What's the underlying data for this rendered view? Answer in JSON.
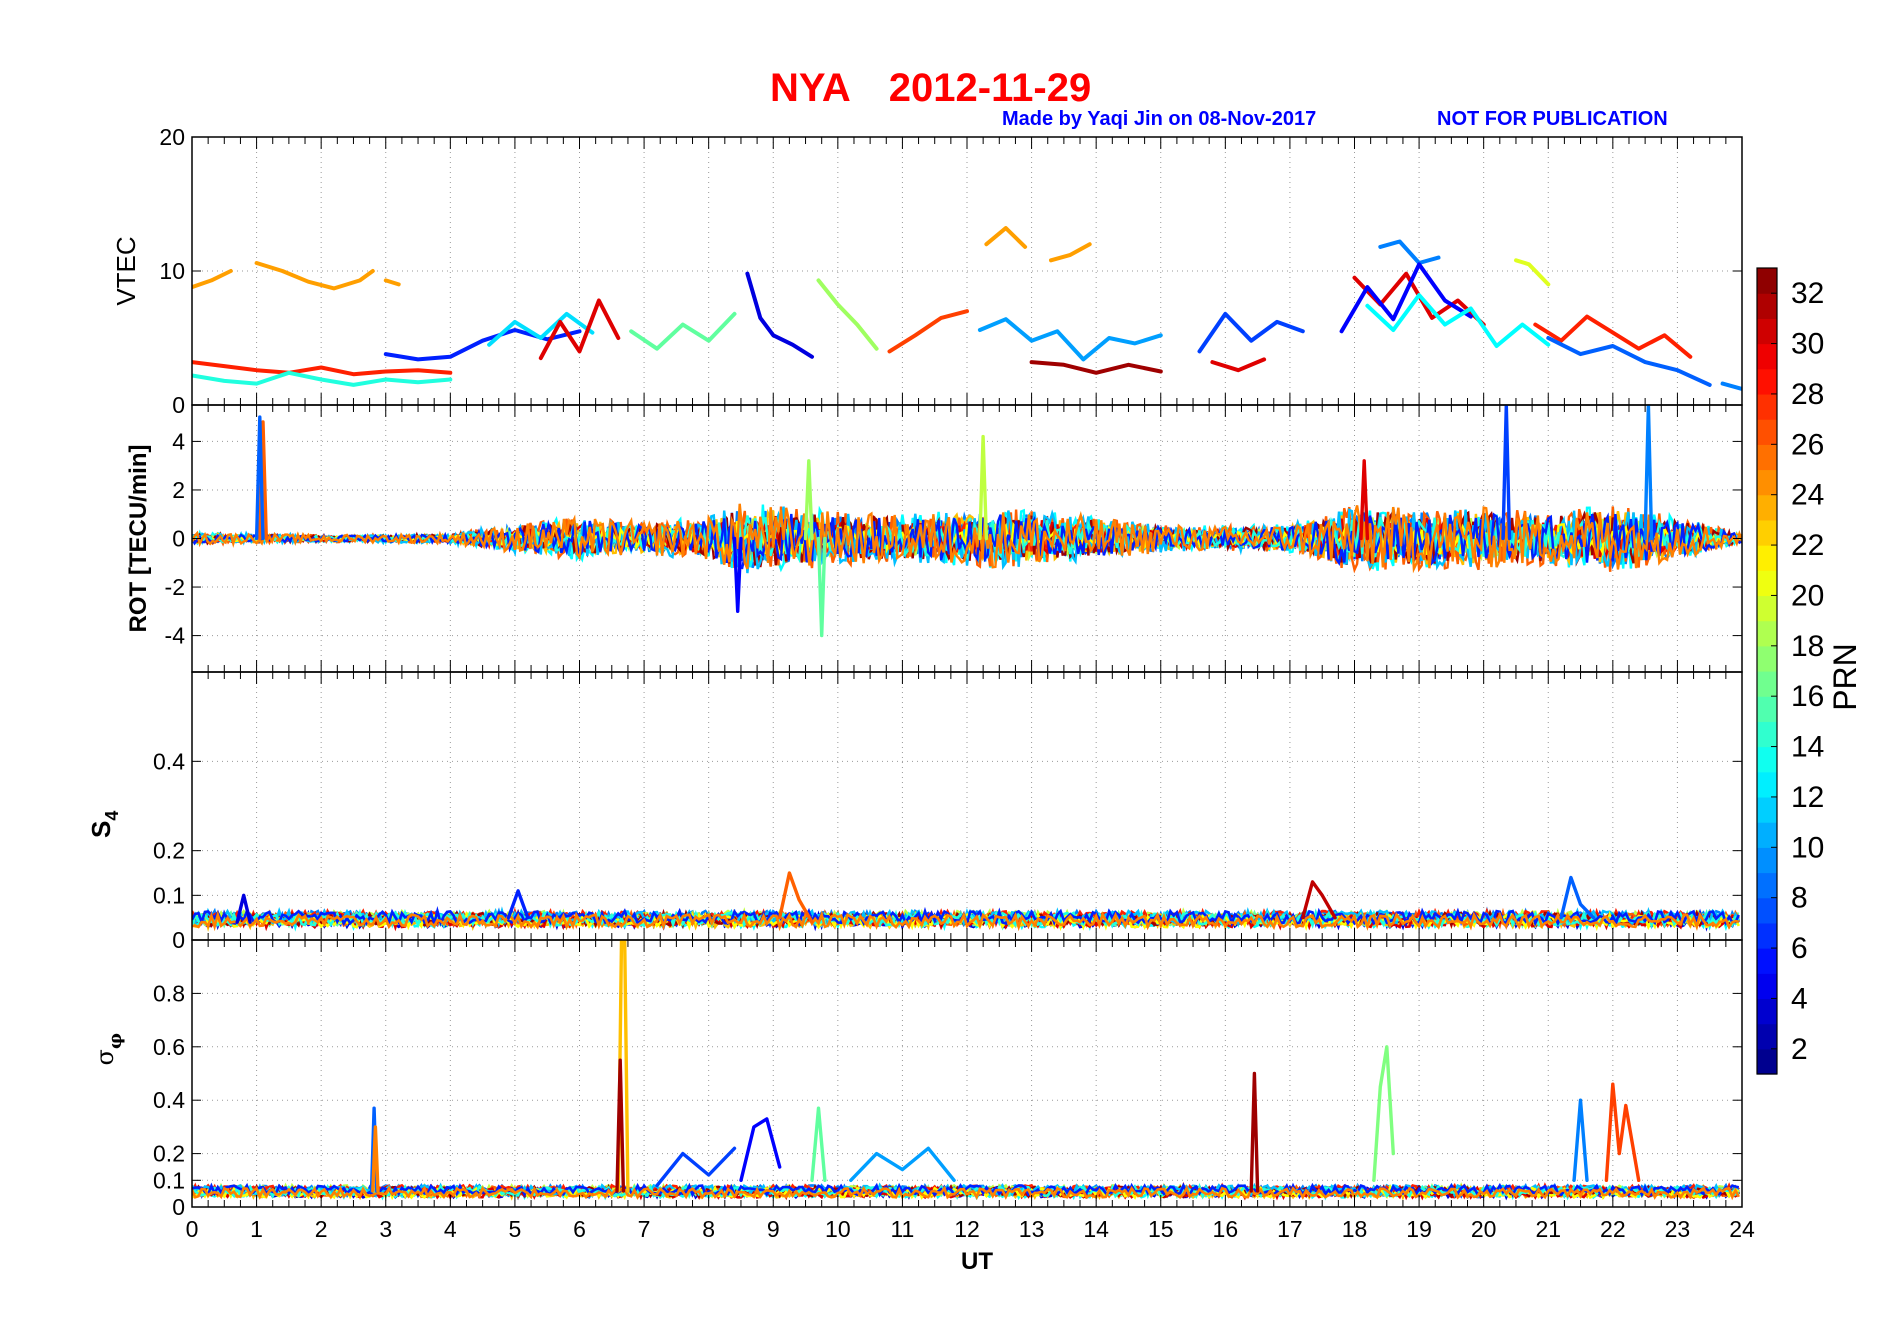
{
  "title": {
    "station": "NYA",
    "date": "2012-11-29"
  },
  "credit": "Made by Yaqi Jin on 08-Nov-2017",
  "notice": "NOT FOR PUBLICATION",
  "colors": {
    "title": "#ff0000",
    "notice": "#0000ff",
    "colormap": "jet"
  },
  "chart_data": [
    {
      "type": "line",
      "panel": "VTEC",
      "ylabel": "VTEC",
      "xlim": [
        0,
        24
      ],
      "ylim": [
        0,
        20
      ],
      "yticks": [
        "0",
        "10",
        "20"
      ],
      "grid": true,
      "series": [
        {
          "prn": 24,
          "x": [
            0.0,
            0.3,
            0.6
          ],
          "y": [
            8.8,
            9.3,
            10.0
          ]
        },
        {
          "prn": 24,
          "x": [
            1.0,
            1.4,
            1.8,
            2.2,
            2.6,
            2.8
          ],
          "y": [
            10.6,
            10.0,
            9.2,
            8.7,
            9.3,
            10.0
          ]
        },
        {
          "prn": 24,
          "x": [
            3.0,
            3.2
          ],
          "y": [
            9.3,
            9.0
          ]
        },
        {
          "prn": 24,
          "x": [
            12.3,
            12.6,
            12.9
          ],
          "y": [
            12.0,
            13.2,
            11.8
          ]
        },
        {
          "prn": 24,
          "x": [
            13.3,
            13.6,
            13.9
          ],
          "y": [
            10.8,
            11.2,
            12.0
          ]
        },
        {
          "prn": 9,
          "x": [
            18.4,
            18.7,
            19.0,
            19.3
          ],
          "y": [
            11.8,
            12.2,
            10.6,
            11.0
          ]
        },
        {
          "prn": 20,
          "x": [
            20.5,
            20.7,
            21.0
          ],
          "y": [
            10.8,
            10.5,
            9.0
          ]
        },
        {
          "prn": 30,
          "x": [
            18.0,
            18.4,
            18.8,
            19.2,
            19.6,
            20.0
          ],
          "y": [
            9.5,
            7.5,
            9.8,
            6.5,
            7.8,
            6.0
          ]
        },
        {
          "prn": 28,
          "x": [
            0.0,
            0.5,
            1.0,
            1.5,
            2.0,
            2.5,
            3.0,
            3.5,
            4.0
          ],
          "y": [
            3.2,
            2.9,
            2.6,
            2.4,
            2.8,
            2.3,
            2.5,
            2.6,
            2.4
          ]
        },
        {
          "prn": 14,
          "x": [
            0.0,
            0.5,
            1.0,
            1.5,
            2.0,
            2.5,
            3.0,
            3.5,
            4.0
          ],
          "y": [
            2.2,
            1.8,
            1.6,
            2.4,
            1.9,
            1.5,
            1.9,
            1.7,
            1.9
          ]
        },
        {
          "prn": 6,
          "x": [
            3.0,
            3.5,
            4.0,
            4.5,
            5.0,
            5.5,
            6.0
          ],
          "y": [
            3.8,
            3.4,
            3.6,
            4.8,
            5.6,
            4.9,
            5.5
          ]
        },
        {
          "prn": 12,
          "x": [
            4.6,
            5.0,
            5.4,
            5.8,
            6.2
          ],
          "y": [
            4.5,
            6.2,
            5.0,
            6.8,
            5.4
          ]
        },
        {
          "prn": 30,
          "x": [
            5.4,
            5.7,
            6.0,
            6.3,
            6.6
          ],
          "y": [
            3.5,
            6.2,
            4.0,
            7.8,
            5.0
          ]
        },
        {
          "prn": 16,
          "x": [
            6.8,
            7.2,
            7.6,
            8.0,
            8.4
          ],
          "y": [
            5.5,
            4.2,
            6.0,
            4.8,
            6.8
          ]
        },
        {
          "prn": 4,
          "x": [
            8.6,
            8.8,
            9.0,
            9.3,
            9.6
          ],
          "y": [
            9.8,
            6.5,
            5.2,
            4.5,
            3.6
          ]
        },
        {
          "prn": 18,
          "x": [
            9.7,
            10.0,
            10.3,
            10.6
          ],
          "y": [
            9.3,
            7.5,
            6.0,
            4.2
          ]
        },
        {
          "prn": 27,
          "x": [
            10.8,
            11.2,
            11.6,
            12.0
          ],
          "y": [
            4.0,
            5.2,
            6.5,
            7.0
          ]
        },
        {
          "prn": 10,
          "x": [
            12.2,
            12.6,
            13.0,
            13.4,
            13.8,
            14.2,
            14.6,
            15.0
          ],
          "y": [
            5.6,
            6.4,
            4.8,
            5.5,
            3.4,
            5.0,
            4.6,
            5.2
          ]
        },
        {
          "prn": 32,
          "x": [
            13.0,
            13.5,
            14.0,
            14.5,
            15.0
          ],
          "y": [
            3.2,
            3.0,
            2.4,
            3.0,
            2.5
          ]
        },
        {
          "prn": 7,
          "x": [
            15.6,
            16.0,
            16.4,
            16.8,
            17.2
          ],
          "y": [
            4.0,
            6.8,
            4.8,
            6.2,
            5.5
          ]
        },
        {
          "prn": 30,
          "x": [
            15.8,
            16.2,
            16.6
          ],
          "y": [
            3.2,
            2.6,
            3.4
          ]
        },
        {
          "prn": 5,
          "x": [
            17.8,
            18.2,
            18.6,
            19.0,
            19.4,
            19.8
          ],
          "y": [
            5.5,
            8.8,
            6.4,
            10.5,
            7.8,
            6.6
          ]
        },
        {
          "prn": 13,
          "x": [
            18.2,
            18.6,
            19.0,
            19.4,
            19.8,
            20.2,
            20.6,
            21.0
          ],
          "y": [
            7.4,
            5.6,
            8.2,
            6.0,
            7.2,
            4.4,
            6.0,
            4.5
          ]
        },
        {
          "prn": 28,
          "x": [
            20.8,
            21.2,
            21.6,
            22.0,
            22.4,
            22.8,
            23.2
          ],
          "y": [
            6.0,
            4.8,
            6.6,
            5.4,
            4.2,
            5.2,
            3.6
          ]
        },
        {
          "prn": 8,
          "x": [
            21.0,
            21.5,
            22.0,
            22.5,
            23.0,
            23.5
          ],
          "y": [
            5.0,
            3.8,
            4.4,
            3.2,
            2.6,
            1.5
          ]
        },
        {
          "prn": 9,
          "x": [
            23.7,
            24.0
          ],
          "y": [
            1.6,
            1.2
          ]
        }
      ]
    },
    {
      "type": "line",
      "panel": "ROT",
      "ylabel": "ROT [TECU/min]",
      "xlim": [
        0,
        24
      ],
      "ylim": [
        -5.5,
        5.5
      ],
      "yticks": [
        "-4",
        "-2",
        "0",
        "2",
        "4"
      ],
      "grid": true,
      "noise_envelope": {
        "x": [
          0,
          2,
          4,
          5,
          6,
          7,
          8,
          8.5,
          9,
          10,
          11,
          12,
          13,
          14,
          15,
          16,
          17,
          18,
          19,
          20,
          21,
          22,
          23,
          24
        ],
        "amp": [
          0.25,
          0.15,
          0.2,
          0.6,
          0.9,
          0.7,
          0.9,
          1.5,
          1.4,
          1.1,
          1.0,
          1.2,
          1.2,
          0.9,
          0.6,
          0.5,
          0.6,
          1.4,
          1.3,
          1.3,
          1.1,
          1.4,
          0.9,
          0.2
        ]
      },
      "series": [
        {
          "prn": 26,
          "x": [
            1.05,
            1.1,
            1.15
          ],
          "y": [
            0.0,
            4.8,
            0.0
          ]
        },
        {
          "prn": 8,
          "x": [
            1.0,
            1.05,
            1.1
          ],
          "y": [
            0.0,
            5.0,
            0.0
          ]
        },
        {
          "prn": 5,
          "x": [
            8.4,
            8.45,
            8.5
          ],
          "y": [
            0.0,
            -3.0,
            0.0
          ]
        },
        {
          "prn": 16,
          "x": [
            9.7,
            9.75,
            9.8
          ],
          "y": [
            0.0,
            -4.0,
            0.0
          ]
        },
        {
          "prn": 18,
          "x": [
            9.5,
            9.55,
            9.6
          ],
          "y": [
            0.0,
            3.2,
            0.0
          ]
        },
        {
          "prn": 19,
          "x": [
            12.2,
            12.25,
            12.3
          ],
          "y": [
            0.0,
            4.2,
            0.0
          ]
        },
        {
          "prn": 7,
          "x": [
            20.3,
            20.35,
            20.4
          ],
          "y": [
            0.0,
            5.5,
            0.0
          ]
        },
        {
          "prn": 9,
          "x": [
            22.5,
            22.55,
            22.6
          ],
          "y": [
            0.0,
            5.5,
            0.0
          ]
        },
        {
          "prn": 30,
          "x": [
            18.1,
            18.15,
            18.2
          ],
          "y": [
            0.0,
            3.2,
            0.0
          ]
        }
      ]
    },
    {
      "type": "line",
      "panel": "S4",
      "ylabel": "S4",
      "xlim": [
        0,
        24
      ],
      "ylim": [
        0,
        0.6
      ],
      "yticks": [
        "0",
        "0.1",
        "0.2",
        "0.4"
      ],
      "grid": true,
      "baseline": 0.04,
      "series": [
        {
          "prn": 26,
          "x": [
            9.1,
            9.25,
            9.4,
            9.6
          ],
          "y": [
            0.05,
            0.15,
            0.09,
            0.04
          ]
        },
        {
          "prn": 31,
          "x": [
            17.2,
            17.35,
            17.5,
            17.7
          ],
          "y": [
            0.05,
            0.13,
            0.1,
            0.05
          ]
        },
        {
          "prn": 8,
          "x": [
            21.2,
            21.35,
            21.5,
            21.7
          ],
          "y": [
            0.05,
            0.14,
            0.08,
            0.05
          ]
        },
        {
          "prn": 6,
          "x": [
            4.9,
            5.05,
            5.2
          ],
          "y": [
            0.05,
            0.11,
            0.05
          ]
        },
        {
          "prn": 4,
          "x": [
            0.7,
            0.8,
            0.9
          ],
          "y": [
            0.04,
            0.1,
            0.04
          ]
        }
      ]
    },
    {
      "type": "line",
      "panel": "sigma_phi",
      "ylabel": "σφ",
      "xlim": [
        0,
        24
      ],
      "ylim": [
        0,
        1
      ],
      "yticks": [
        "0",
        "0.1",
        "0.2",
        "0.4",
        "0.6",
        "0.8"
      ],
      "xticks": [
        "0",
        "1",
        "2",
        "3",
        "4",
        "5",
        "6",
        "7",
        "8",
        "9",
        "10",
        "11",
        "12",
        "13",
        "14",
        "15",
        "16",
        "17",
        "18",
        "19",
        "20",
        "21",
        "22",
        "23",
        "24"
      ],
      "xlabel": "UT",
      "grid": true,
      "baseline": 0.05,
      "series": [
        {
          "prn": 23,
          "x": [
            6.6,
            6.65,
            6.7,
            6.75
          ],
          "y": [
            0.06,
            1.0,
            1.0,
            0.06
          ]
        },
        {
          "prn": 32,
          "x": [
            6.58,
            6.63,
            6.68
          ],
          "y": [
            0.06,
            0.55,
            0.06
          ]
        },
        {
          "prn": 8,
          "x": [
            2.78,
            2.82,
            2.86
          ],
          "y": [
            0.06,
            0.37,
            0.06
          ]
        },
        {
          "prn": 25,
          "x": [
            2.8,
            2.84,
            2.88
          ],
          "y": [
            0.06,
            0.3,
            0.06
          ]
        },
        {
          "prn": 32,
          "x": [
            16.4,
            16.45,
            16.5
          ],
          "y": [
            0.06,
            0.5,
            0.06
          ]
        },
        {
          "prn": 17,
          "x": [
            18.3,
            18.4,
            18.5,
            18.6
          ],
          "y": [
            0.1,
            0.45,
            0.6,
            0.2
          ]
        },
        {
          "prn": 27,
          "x": [
            21.9,
            22.0,
            22.1,
            22.2,
            22.4
          ],
          "y": [
            0.1,
            0.46,
            0.2,
            0.38,
            0.1
          ]
        },
        {
          "prn": 5,
          "x": [
            8.5,
            8.7,
            8.9,
            9.1
          ],
          "y": [
            0.1,
            0.3,
            0.33,
            0.15
          ]
        },
        {
          "prn": 16,
          "x": [
            9.6,
            9.7,
            9.8
          ],
          "y": [
            0.1,
            0.37,
            0.1
          ]
        },
        {
          "prn": 9,
          "x": [
            21.4,
            21.5,
            21.6
          ],
          "y": [
            0.1,
            0.4,
            0.1
          ]
        },
        {
          "prn": 7,
          "x": [
            7.2,
            7.6,
            8.0,
            8.4
          ],
          "y": [
            0.08,
            0.2,
            0.12,
            0.22
          ]
        },
        {
          "prn": 10,
          "x": [
            10.2,
            10.6,
            11.0,
            11.4,
            11.8
          ],
          "y": [
            0.1,
            0.2,
            0.14,
            0.22,
            0.1
          ]
        }
      ]
    }
  ],
  "colorbar": {
    "label": "PRN",
    "range": [
      1,
      33
    ],
    "ticks": [
      "2",
      "4",
      "6",
      "8",
      "10",
      "12",
      "14",
      "16",
      "18",
      "20",
      "22",
      "24",
      "26",
      "28",
      "30",
      "32"
    ]
  }
}
